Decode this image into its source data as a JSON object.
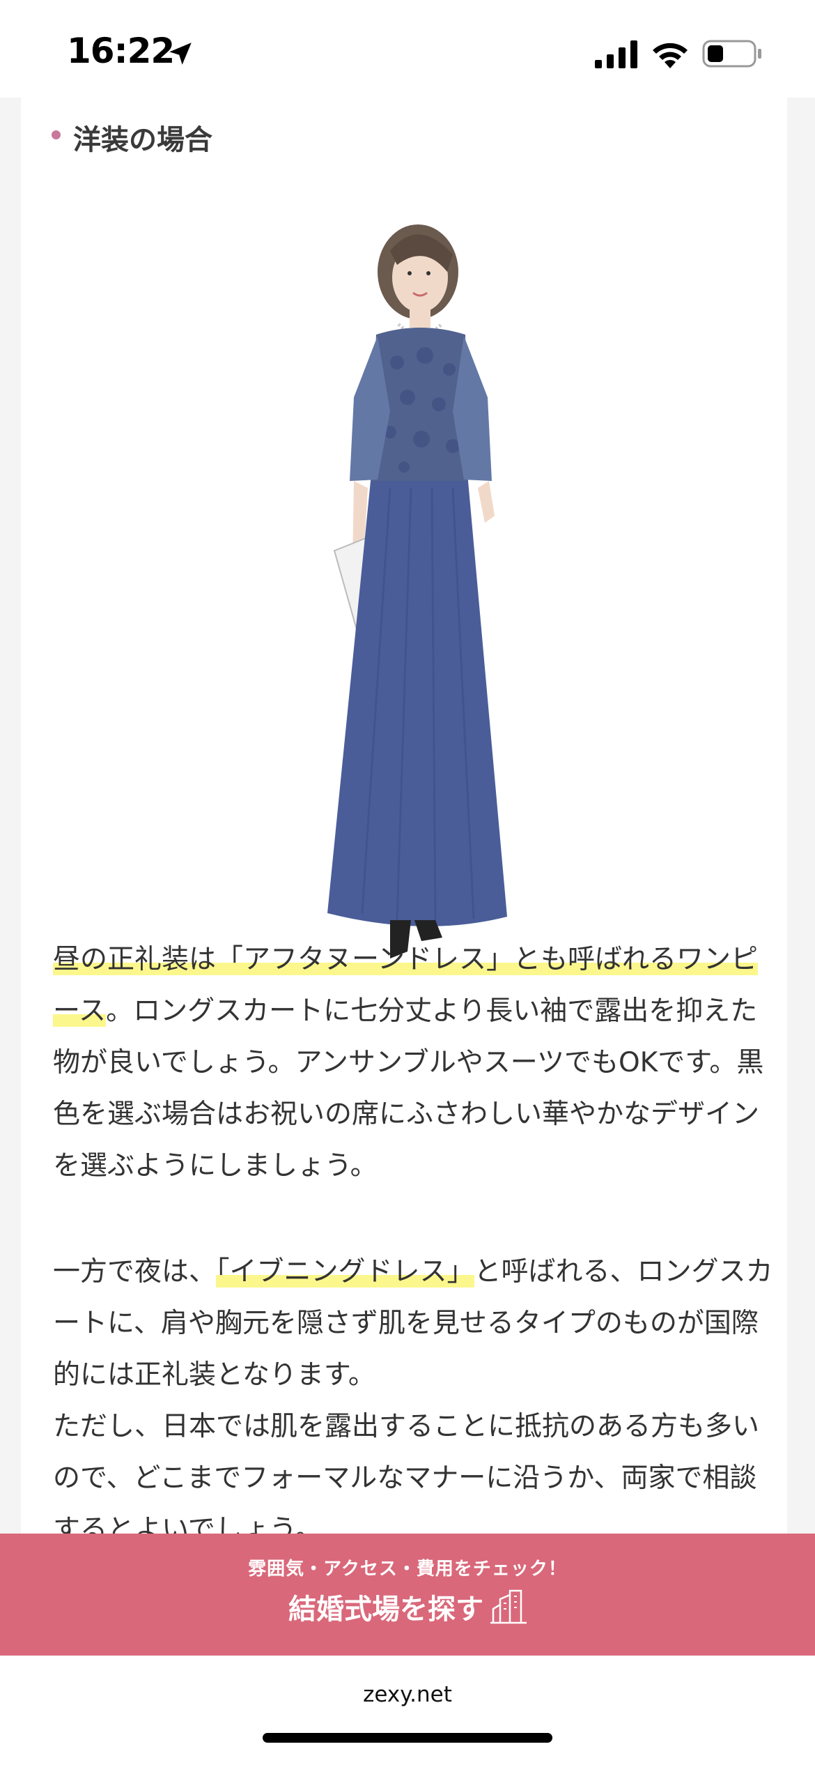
{
  "status_bar": {
    "time": "16:22"
  },
  "section": {
    "subhead": "洋装の場合"
  },
  "content": {
    "p1_hl": "昼の正礼装は「アフタヌーンドレス」とも呼ばれるワンピース",
    "p1_rest": "。ロングスカートに七分丈より長い袖で露出を抑えた物が良いでしょう。アンサンブルやスーツでもOKです。黒色を選ぶ場合はお祝いの席にふさわしい華やかなデザインを選ぶようにしましょう。",
    "p2_pre": "一方で夜は、",
    "p2_hl": "「イブニングドレス」",
    "p2_rest": "と呼ばれる、ロングスカートに、肩や胸元を隠さず肌を見せるタイプのものが国際的には正礼装となります。",
    "p3": "ただし、日本では肌を露出することに抵抗のある方も多いので、どこまでフォーマルなマナーに沿うか、両家で相談するとよいでしょう。"
  },
  "banner": {
    "subtitle": "雰囲気・アクセス・費用をチェック！",
    "title": "結婚式場を探す"
  },
  "browser": {
    "url": "zexy.net"
  },
  "colors": {
    "banner": "#d9687a",
    "highlight": "#fbf78c",
    "bullet": "#c9779a",
    "dress": "#4a5d99"
  },
  "icons": [
    "location-arrow-icon",
    "signal-icon",
    "wifi-icon",
    "battery-icon",
    "building-icon"
  ]
}
